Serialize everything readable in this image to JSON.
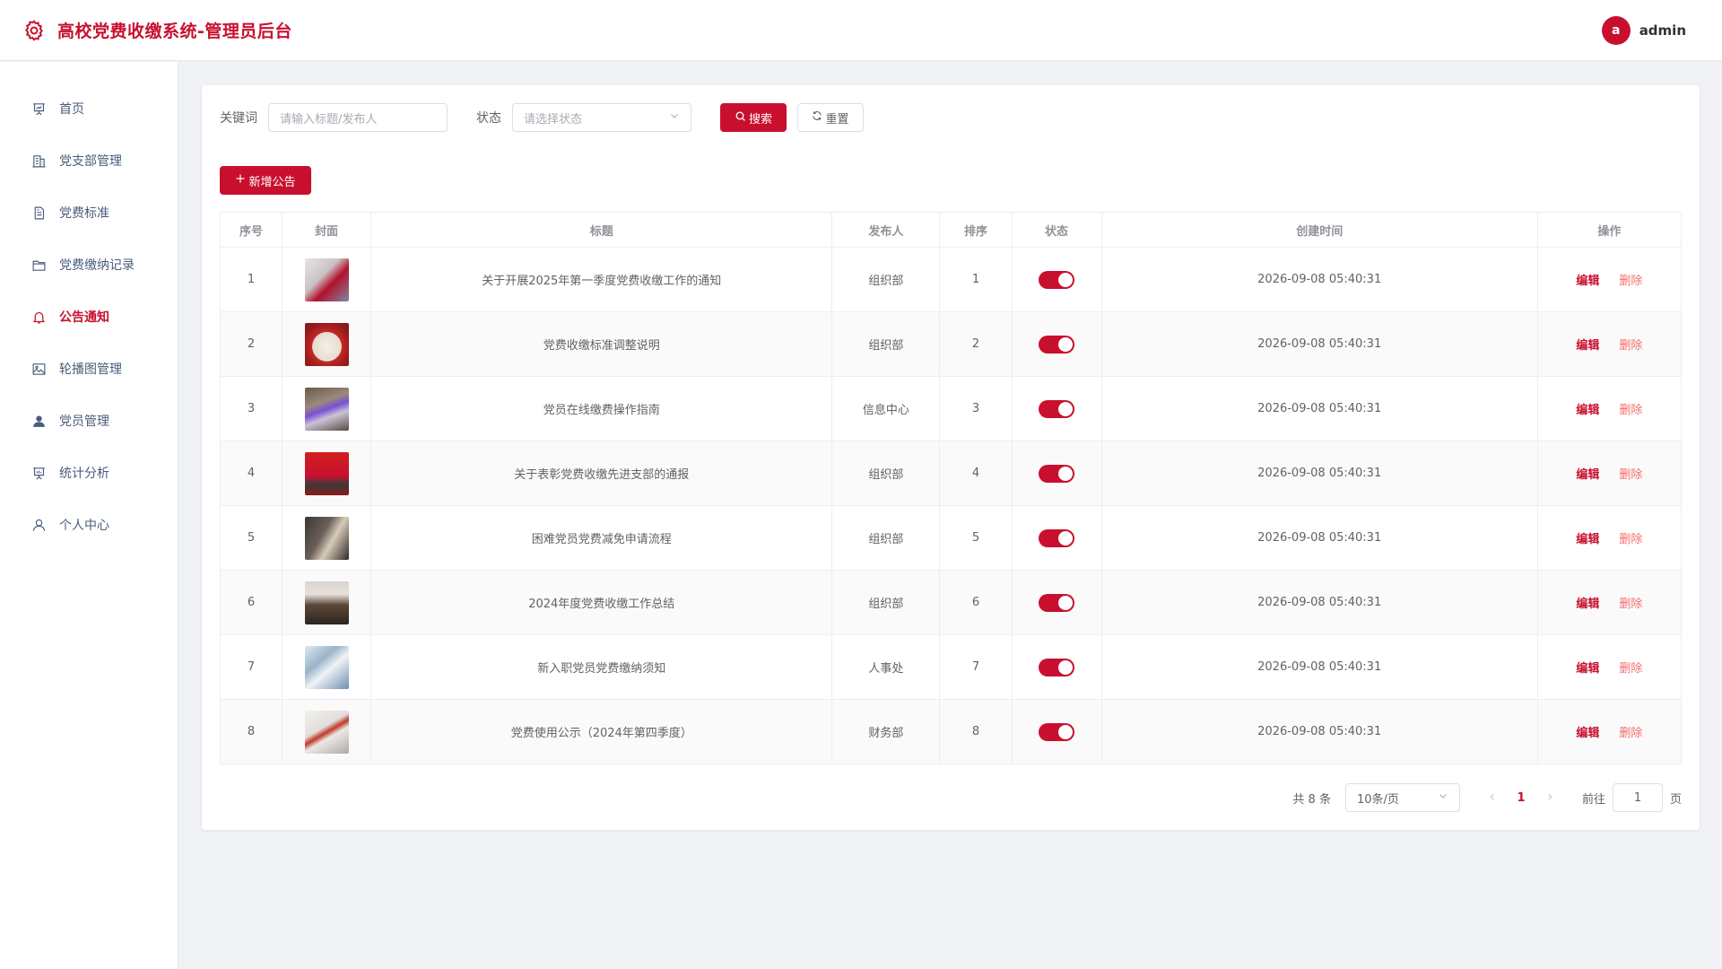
{
  "header": {
    "title": "高校党费收缴系统-管理员后台",
    "avatar_letter": "a",
    "username": "admin"
  },
  "colors": {
    "accent": "#c8102e",
    "danger": "#f56c6c"
  },
  "sidebar": {
    "items": [
      {
        "label": "首页",
        "icon": "presentation-icon",
        "active": false
      },
      {
        "label": "党支部管理",
        "icon": "building-icon",
        "active": false
      },
      {
        "label": "党费标准",
        "icon": "document-icon",
        "active": false
      },
      {
        "label": "党费缴纳记录",
        "icon": "folder-icon",
        "active": false
      },
      {
        "label": "公告通知",
        "icon": "bell-icon",
        "active": true
      },
      {
        "label": "轮播图管理",
        "icon": "picture-icon",
        "active": false
      },
      {
        "label": "党员管理",
        "icon": "user-filled-icon",
        "active": false
      },
      {
        "label": "统计分析",
        "icon": "chart-board-icon",
        "active": false
      },
      {
        "label": "个人中心",
        "icon": "user-icon",
        "active": false
      }
    ]
  },
  "filters": {
    "keyword_label": "关键词",
    "keyword_placeholder": "请输入标题/发布人",
    "status_label": "状态",
    "status_placeholder": "请选择状态",
    "search_label": "搜索",
    "reset_label": "重置"
  },
  "add_button_label": "新增公告",
  "table": {
    "columns": [
      "序号",
      "封面",
      "标题",
      "发布人",
      "排序",
      "状态",
      "创建时间",
      "操作"
    ],
    "edit_label": "编辑",
    "delete_label": "删除",
    "rows": [
      {
        "index": "1",
        "title": "关于开展2025年第一季度党费收缴工作的通知",
        "publisher": "组织部",
        "sort": "1",
        "status": true,
        "created": "2026-09-08 05:40:31"
      },
      {
        "index": "2",
        "title": "党费收缴标准调整说明",
        "publisher": "组织部",
        "sort": "2",
        "status": true,
        "created": "2026-09-08 05:40:31"
      },
      {
        "index": "3",
        "title": "党员在线缴费操作指南",
        "publisher": "信息中心",
        "sort": "3",
        "status": true,
        "created": "2026-09-08 05:40:31"
      },
      {
        "index": "4",
        "title": "关于表彰党费收缴先进支部的通报",
        "publisher": "组织部",
        "sort": "4",
        "status": true,
        "created": "2026-09-08 05:40:31"
      },
      {
        "index": "5",
        "title": "困难党员党费减免申请流程",
        "publisher": "组织部",
        "sort": "5",
        "status": true,
        "created": "2026-09-08 05:40:31"
      },
      {
        "index": "6",
        "title": "2024年度党费收缴工作总结",
        "publisher": "组织部",
        "sort": "6",
        "status": true,
        "created": "2026-09-08 05:40:31"
      },
      {
        "index": "7",
        "title": "新入职党员党费缴纳须知",
        "publisher": "人事处",
        "sort": "7",
        "status": true,
        "created": "2026-09-08 05:40:31"
      },
      {
        "index": "8",
        "title": "党费使用公示（2024年第四季度）",
        "publisher": "财务部",
        "sort": "8",
        "status": true,
        "created": "2026-09-08 05:40:31"
      }
    ]
  },
  "pagination": {
    "total_text": "共 8 条",
    "page_size": "10条/页",
    "current_page": "1",
    "goto_label": "前往",
    "goto_value": "1",
    "page_unit": "页"
  }
}
